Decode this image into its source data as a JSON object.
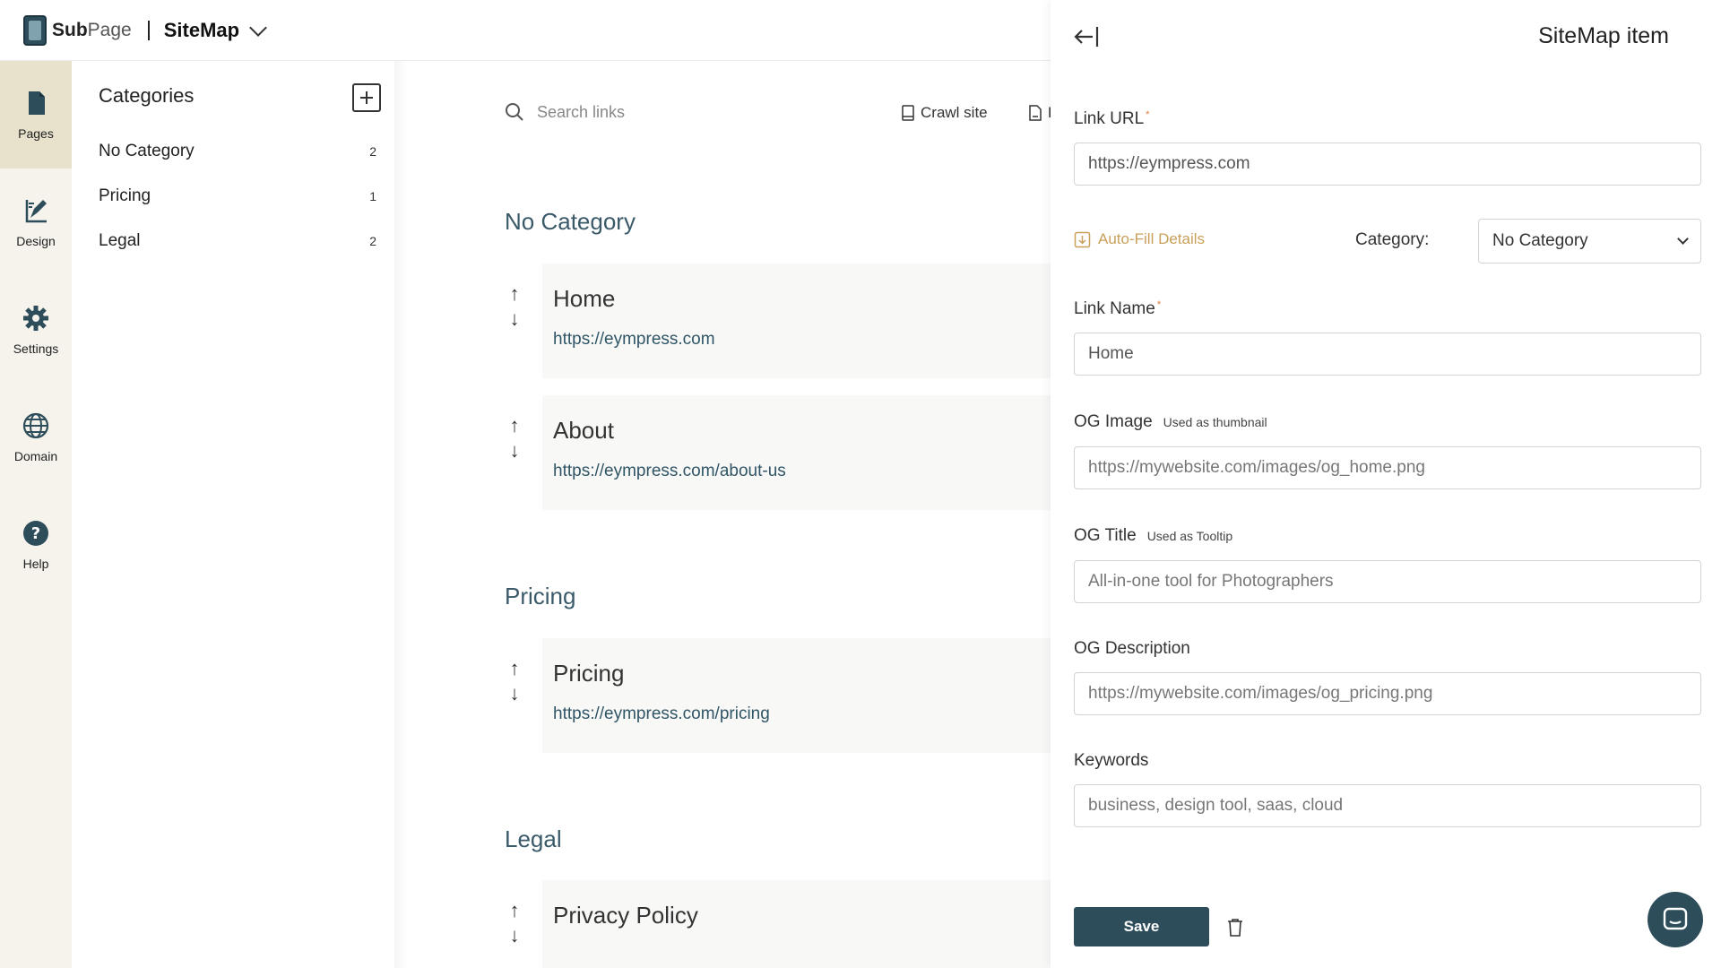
{
  "app": {
    "logo_bold": "Sub",
    "logo_rest": "Page",
    "title": "SiteMap"
  },
  "nav": {
    "items": [
      {
        "label": "Pages",
        "icon": "page-icon",
        "active": true
      },
      {
        "label": "Design",
        "icon": "design-icon",
        "active": false
      },
      {
        "label": "Settings",
        "icon": "gear-icon",
        "active": false
      },
      {
        "label": "Domain",
        "icon": "globe-icon",
        "active": false
      },
      {
        "label": "Help",
        "icon": "help-icon",
        "active": false
      }
    ]
  },
  "categories": {
    "header": "Categories",
    "items": [
      {
        "name": "No Category",
        "count": "2"
      },
      {
        "name": "Pricing",
        "count": "1"
      },
      {
        "name": "Legal",
        "count": "2"
      }
    ]
  },
  "main": {
    "search_placeholder": "Search links",
    "crawl_label": "Crawl site",
    "export_label": "E",
    "sections": [
      {
        "title": "No Category",
        "links": [
          {
            "name": "Home",
            "url": "https://eympress.com"
          },
          {
            "name": "About",
            "url": "https://eympress.com/about-us"
          }
        ]
      },
      {
        "title": "Pricing",
        "links": [
          {
            "name": "Pricing",
            "url": "https://eympress.com/pricing"
          }
        ]
      },
      {
        "title": "Legal",
        "links": [
          {
            "name": "Privacy Policy",
            "url": ""
          }
        ]
      }
    ],
    "arrows_up": "↑",
    "arrows_down": "↓"
  },
  "panel": {
    "title": "SiteMap item",
    "required_mark": "*",
    "link_url_label": "Link URL",
    "link_url_value": "https://eympress.com",
    "autofill_label": "Auto-Fill Details",
    "category_label": "Category:",
    "category_value": "No Category",
    "link_name_label": "Link Name",
    "link_name_value": "Home",
    "og_image_label": "OG Image",
    "og_image_hint": "Used as thumbnail",
    "og_image_placeholder": "https://mywebsite.com/images/og_home.png",
    "og_title_label": "OG Title",
    "og_title_hint": "Used as Tooltip",
    "og_title_placeholder": "All-in-one tool for Photographers",
    "og_desc_label": "OG Description",
    "og_desc_placeholder": "https://mywebsite.com/images/og_pricing.png",
    "keywords_label": "Keywords",
    "keywords_placeholder": "business, design tool, saas, cloud",
    "save_label": "Save"
  },
  "colors": {
    "primary": "#2d4d5a",
    "nav_bg": "#f5f3ec",
    "nav_active": "#e8e1cc",
    "accent": "#c9a05a",
    "required": "#e07a3a"
  }
}
